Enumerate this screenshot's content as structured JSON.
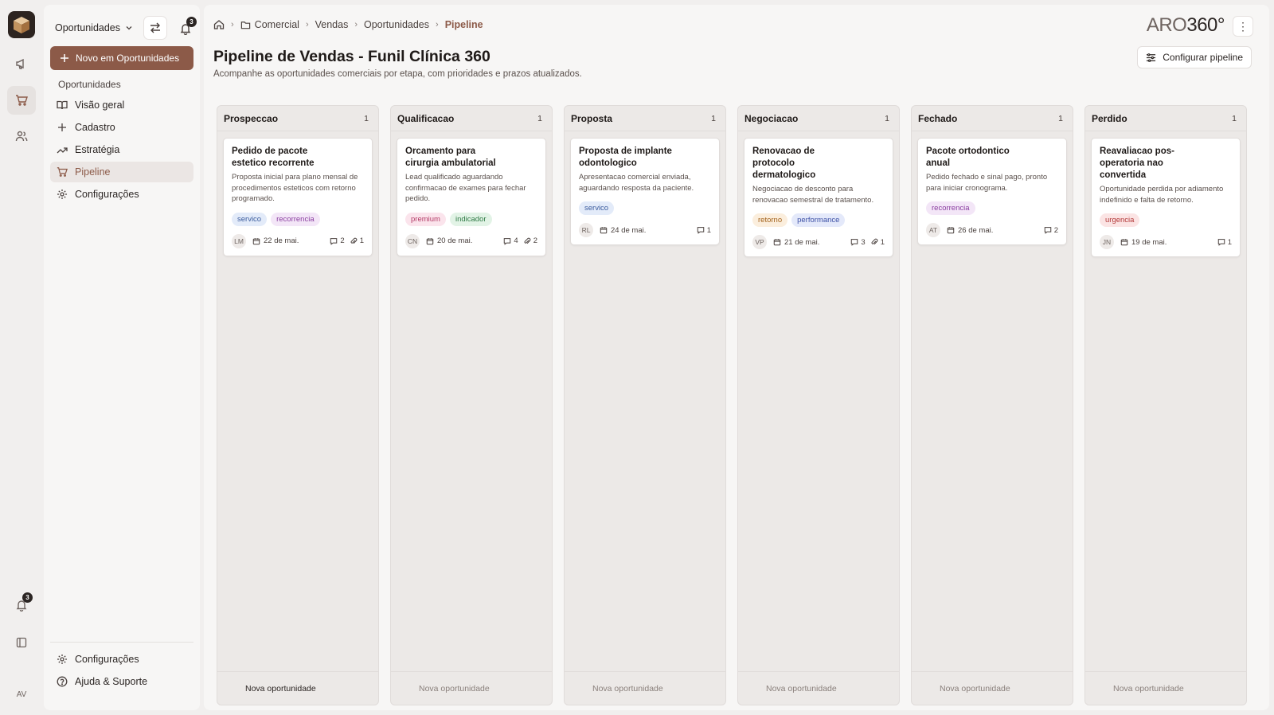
{
  "rail": {
    "notification_count": "3",
    "avatar_initials": "AV"
  },
  "sidebar": {
    "module_label": "Oportunidades",
    "notification_count": "3",
    "new_button_label": "Novo em Oportunidades",
    "section_label": "Oportunidades",
    "items": [
      {
        "label": "Visão geral",
        "icon": "book-icon"
      },
      {
        "label": "Cadastro",
        "icon": "plus-icon"
      },
      {
        "label": "Estratégia",
        "icon": "trend-icon"
      },
      {
        "label": "Pipeline",
        "icon": "cart-icon",
        "active": true
      },
      {
        "label": "Configurações",
        "icon": "gear-icon"
      }
    ],
    "footer": [
      {
        "label": "Configurações",
        "icon": "gear-icon"
      },
      {
        "label": "Ajuda & Suporte",
        "icon": "help-icon"
      }
    ]
  },
  "breadcrumb": [
    "Comercial",
    "Vendas",
    "Oportunidades",
    "Pipeline"
  ],
  "brand": {
    "part1": "ARO",
    "part2": "360°"
  },
  "page": {
    "title": "Pipeline de Vendas - Funil Clínica 360",
    "subtitle": "Acompanhe as oportunidades comerciais por etapa, com prioridades e prazos atualizados.",
    "config_button": "Configurar pipeline"
  },
  "tag_colors": {
    "servico": {
      "bg": "#e3ebf9",
      "fg": "#3b5c9e"
    },
    "recorrencia": {
      "bg": "#f3e6f7",
      "fg": "#8a3ea0"
    },
    "premium": {
      "bg": "#fbe4ec",
      "fg": "#b23a66"
    },
    "indicador": {
      "bg": "#e2f3e6",
      "fg": "#2f7a45"
    },
    "retorno": {
      "bg": "#fbeedd",
      "fg": "#a3631c"
    },
    "performance": {
      "bg": "#e4e9fa",
      "fg": "#3f52a6"
    },
    "urgencia": {
      "bg": "#fbe4e4",
      "fg": "#b33a3a"
    }
  },
  "columns": [
    {
      "name": "Prospeccao",
      "count": "1",
      "footer": "Nova oportunidade",
      "card": {
        "title": "Pedido de pacote estetico recorrente",
        "description": "Proposta inicial para plano mensal de procedimentos esteticos com retorno programado.",
        "tags": [
          "servico",
          "recorrencia"
        ],
        "avatar": "LM",
        "date": "22 de mai.",
        "comments": "2",
        "attachments": "1"
      }
    },
    {
      "name": "Qualificacao",
      "count": "1",
      "footer": "Nova oportunidade",
      "card": {
        "title": "Orcamento para cirurgia ambulatorial",
        "description": "Lead qualificado aguardando confirmacao de exames para fechar pedido.",
        "tags": [
          "premium",
          "indicador"
        ],
        "avatar": "CN",
        "date": "20 de mai.",
        "comments": "4",
        "attachments": "2"
      }
    },
    {
      "name": "Proposta",
      "count": "1",
      "footer": "Nova oportunidade",
      "card": {
        "title": "Proposta de implante odontologico",
        "description": "Apresentacao comercial enviada, aguardando resposta da paciente.",
        "tags": [
          "servico"
        ],
        "avatar": "RL",
        "date": "24 de mai.",
        "comments": "1",
        "attachments": ""
      }
    },
    {
      "name": "Negociacao",
      "count": "1",
      "footer": "Nova oportunidade",
      "card": {
        "title": "Renovacao de protocolo dermatologico",
        "description": "Negociacao de desconto para renovacao semestral de tratamento.",
        "tags": [
          "retorno",
          "performance"
        ],
        "avatar": "VP",
        "date": "21 de mai.",
        "comments": "3",
        "attachments": "1"
      }
    },
    {
      "name": "Fechado",
      "count": "1",
      "footer": "Nova oportunidade",
      "card": {
        "title": "Pacote ortodontico anual",
        "description": "Pedido fechado e sinal pago, pronto para iniciar cronograma.",
        "tags": [
          "recorrencia"
        ],
        "avatar": "AT",
        "date": "26 de mai.",
        "comments": "2",
        "attachments": ""
      }
    },
    {
      "name": "Perdido",
      "count": "1",
      "footer": "Nova oportunidade",
      "card": {
        "title": "Reavaliacao pos-operatoria nao convertida",
        "description": "Oportunidade perdida por adiamento indefinido e falta de retorno.",
        "tags": [
          "urgencia"
        ],
        "avatar": "JN",
        "date": "19 de mai.",
        "comments": "1",
        "attachments": ""
      }
    }
  ]
}
